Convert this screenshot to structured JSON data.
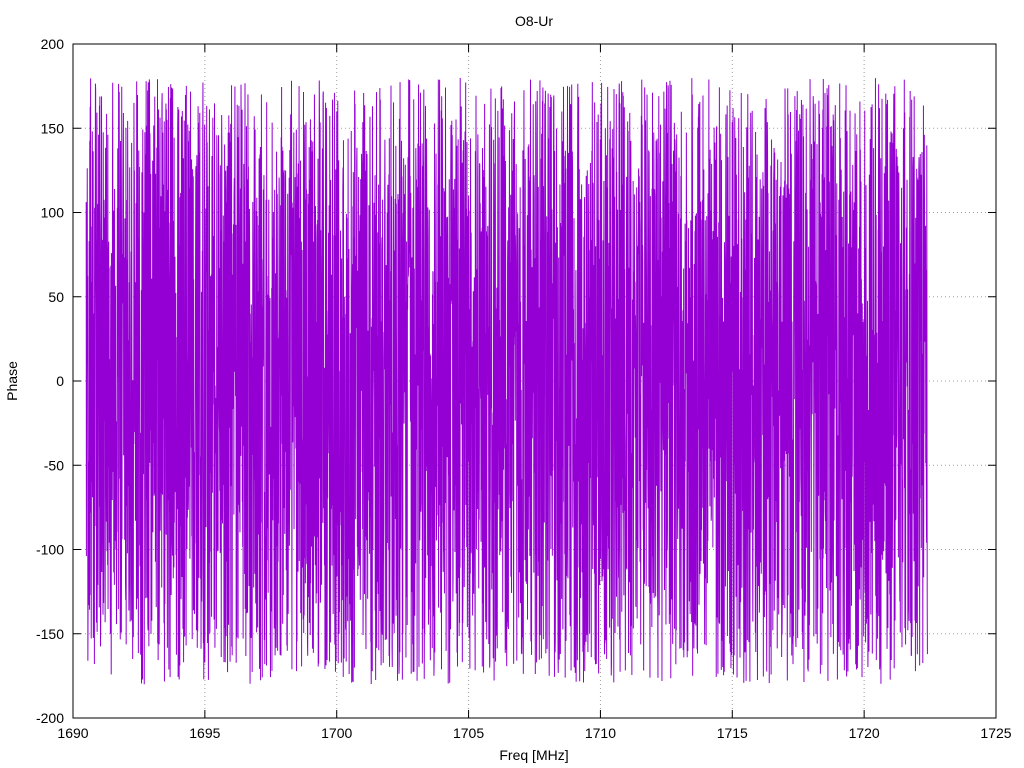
{
  "chart_data": {
    "type": "line",
    "title": "O8-Ur",
    "xlabel": "Freq [MHz]",
    "ylabel": "Phase",
    "xlim": [
      1690,
      1725
    ],
    "ylim": [
      -200,
      200
    ],
    "xticks": [
      1690,
      1695,
      1700,
      1705,
      1710,
      1715,
      1720,
      1725
    ],
    "yticks": [
      -200,
      -150,
      -100,
      -50,
      0,
      50,
      100,
      150,
      200
    ],
    "grid": true,
    "legend": "none",
    "series": [
      {
        "color": "#9400D3",
        "x_start": 1690.5,
        "x_end": 1722.4,
        "n_points": 4000,
        "y_min": -180,
        "y_max": 180,
        "pattern": "uniform_wrapped_phase",
        "seed": 9183
      }
    ]
  }
}
